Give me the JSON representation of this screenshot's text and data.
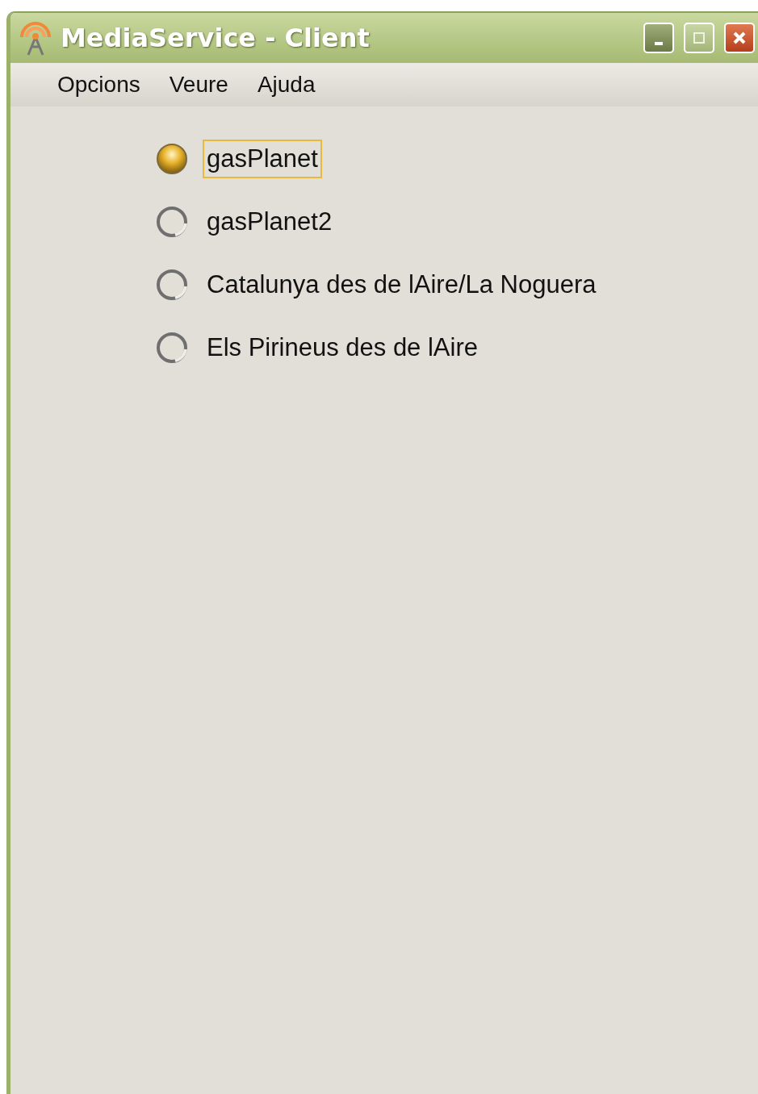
{
  "window": {
    "title": "MediaService - Client"
  },
  "menu": [
    "Opcions",
    "Veure",
    "Ajuda"
  ],
  "options": [
    {
      "label": "gasPlanet",
      "selected": true,
      "focused": true
    },
    {
      "label": "gasPlanet2",
      "selected": false,
      "focused": false
    },
    {
      "label": "Catalunya des de lAire/La Noguera",
      "selected": false,
      "focused": false
    },
    {
      "label": "Els Pirineus des de lAire",
      "selected": false,
      "focused": false
    }
  ]
}
